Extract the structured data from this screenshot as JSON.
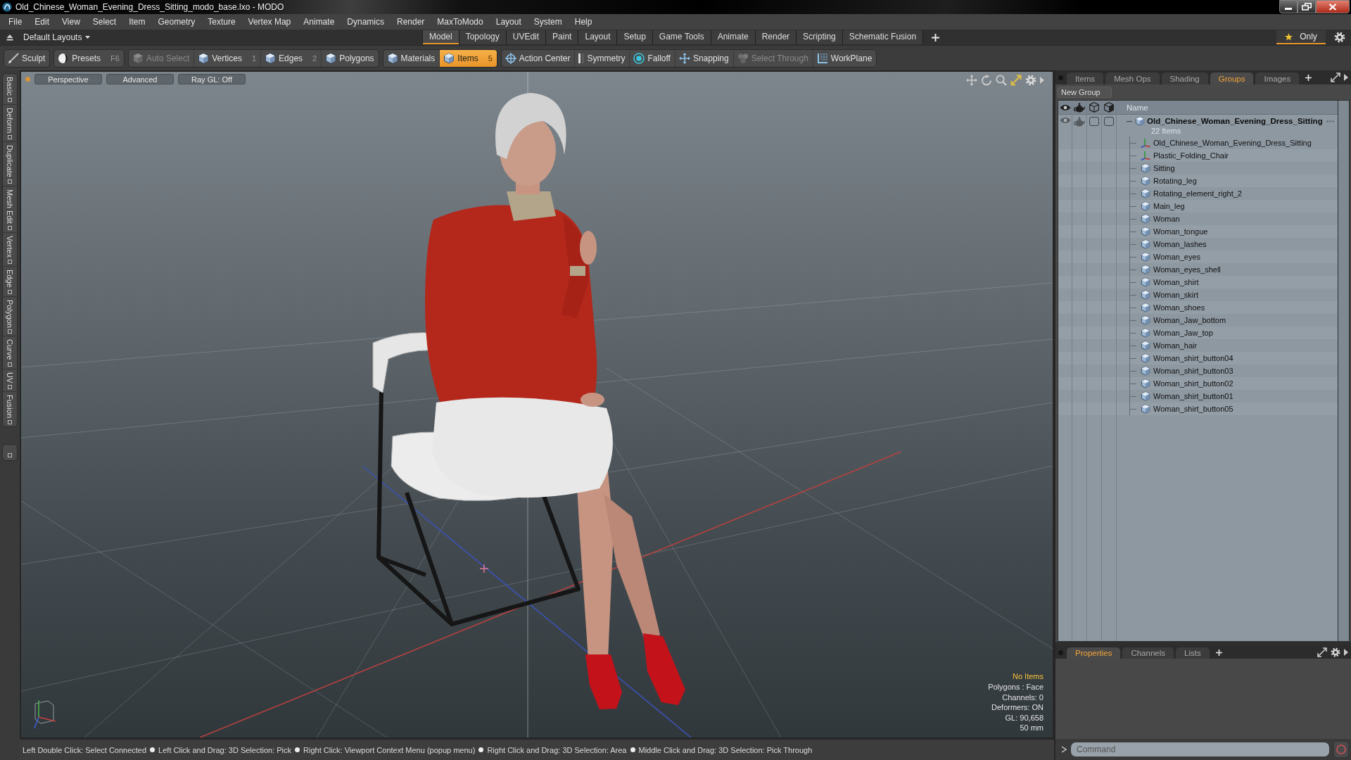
{
  "window": {
    "title": "Old_Chinese_Woman_Evening_Dress_Sitting_modo_base.lxo - MODO"
  },
  "menu": [
    "File",
    "Edit",
    "View",
    "Select",
    "Item",
    "Geometry",
    "Texture",
    "Vertex Map",
    "Animate",
    "Dynamics",
    "Render",
    "MaxToModo",
    "Layout",
    "System",
    "Help"
  ],
  "layout_bar": {
    "preset": "Default Layouts",
    "tabs": [
      {
        "label": "Model",
        "selected": true
      },
      {
        "label": "Topology",
        "selected": false
      },
      {
        "label": "UVEdit",
        "selected": false
      },
      {
        "label": "Paint",
        "selected": false
      },
      {
        "label": "Layout",
        "selected": false
      },
      {
        "label": "Setup",
        "selected": false
      },
      {
        "label": "Game Tools",
        "selected": false
      },
      {
        "label": "Animate",
        "selected": false
      },
      {
        "label": "Render",
        "selected": false
      },
      {
        "label": "Scripting",
        "selected": false
      },
      {
        "label": "Schematic Fusion",
        "selected": false
      }
    ],
    "only": "Only"
  },
  "toolbar": [
    {
      "items": [
        {
          "label": "Sculpt",
          "selected": false,
          "disabled": false
        }
      ]
    },
    {
      "items": [
        {
          "label": "Presets",
          "shortcut": "F6",
          "selected": false,
          "disabled": false
        }
      ]
    },
    {
      "items": [
        {
          "label": "Auto Select",
          "selected": false,
          "disabled": true
        },
        {
          "label": "Vertices",
          "shortcut": "1",
          "selected": false,
          "disabled": false
        },
        {
          "label": "Edges",
          "shortcut": "2",
          "selected": false,
          "disabled": false
        },
        {
          "label": "Polygons",
          "selected": false,
          "disabled": false
        }
      ]
    },
    {
      "items": [
        {
          "label": "Materials",
          "selected": false,
          "disabled": false
        },
        {
          "label": "Items",
          "shortcut": "5",
          "selected": true,
          "disabled": false
        }
      ]
    },
    {
      "items": [
        {
          "label": "Action Center",
          "selected": false,
          "disabled": false
        },
        {
          "label": "Symmetry",
          "selected": false,
          "disabled": false
        },
        {
          "label": "Falloff",
          "selected": false,
          "disabled": false
        },
        {
          "label": "Snapping",
          "selected": false,
          "disabled": false
        },
        {
          "label": "Select Through",
          "selected": false,
          "disabled": true
        },
        {
          "label": "WorkPlane",
          "selected": false,
          "disabled": false
        }
      ]
    }
  ],
  "side_tabs": [
    "Basic",
    "Deform",
    "Duplicate",
    "Mesh Edit",
    "Vertex",
    "Edge",
    "Polygon",
    "Curve",
    "UV",
    "Fusion"
  ],
  "viewport": {
    "buttons": [
      "Perspective",
      "Advanced",
      "Ray GL: Off"
    ],
    "info": [
      {
        "text": "No Items",
        "kind": "highlight"
      },
      {
        "text": "Polygons : Face",
        "kind": "plain"
      },
      {
        "text": "Channels: 0",
        "kind": "plain"
      },
      {
        "text": "Deformers: ON",
        "kind": "plain"
      },
      {
        "text": "GL: 90,658",
        "kind": "plain"
      },
      {
        "text": "50 mm",
        "kind": "plain"
      }
    ]
  },
  "status_bar": {
    "hints": [
      "Left Double Click: Select Connected",
      "Left Click and Drag: 3D Selection: Pick",
      "Right Click: Viewport Context Menu (popup menu)",
      "Right Click and Drag: 3D Selection: Area",
      "Middle Click and Drag: 3D Selection: Pick Through"
    ]
  },
  "panel_tabs": [
    {
      "label": "Items",
      "selected": false
    },
    {
      "label": "Mesh Ops",
      "selected": false
    },
    {
      "label": "Shading",
      "selected": false
    },
    {
      "label": "Groups",
      "selected": true
    },
    {
      "label": "Images",
      "selected": false
    }
  ],
  "groups": {
    "new_group": "New Group",
    "name_column": "Name",
    "root": {
      "name": "Old_Chinese_Woman_Evening_Dress_Sitting",
      "count": "22 Items",
      "expanded": true,
      "children": [
        {
          "name": "Old_Chinese_Woman_Evening_Dress_Sitting",
          "kind": "locator"
        },
        {
          "name": "Plastic_Folding_Chair",
          "kind": "locator"
        },
        {
          "name": "Sitting",
          "kind": "mesh"
        },
        {
          "name": "Rotating_leg",
          "kind": "mesh"
        },
        {
          "name": "Rotating_element_right_2",
          "kind": "mesh"
        },
        {
          "name": "Main_leg",
          "kind": "mesh"
        },
        {
          "name": "Woman",
          "kind": "mesh"
        },
        {
          "name": "Woman_tongue",
          "kind": "mesh"
        },
        {
          "name": "Woman_lashes",
          "kind": "mesh"
        },
        {
          "name": "Woman_eyes",
          "kind": "mesh"
        },
        {
          "name": "Woman_eyes_shell",
          "kind": "mesh"
        },
        {
          "name": "Woman_shirt",
          "kind": "mesh"
        },
        {
          "name": "Woman_skirt",
          "kind": "mesh"
        },
        {
          "name": "Woman_shoes",
          "kind": "mesh"
        },
        {
          "name": "Woman_Jaw_bottom",
          "kind": "mesh"
        },
        {
          "name": "Woman_Jaw_top",
          "kind": "mesh"
        },
        {
          "name": "Woman_hair",
          "kind": "mesh"
        },
        {
          "name": "Woman_shirt_button04",
          "kind": "mesh"
        },
        {
          "name": "Woman_shirt_button03",
          "kind": "mesh"
        },
        {
          "name": "Woman_shirt_button02",
          "kind": "mesh"
        },
        {
          "name": "Woman_shirt_button01",
          "kind": "mesh"
        },
        {
          "name": "Woman_shirt_button05",
          "kind": "mesh"
        }
      ]
    }
  },
  "properties_tabs": [
    {
      "label": "Properties",
      "selected": true
    },
    {
      "label": "Channels",
      "selected": false
    },
    {
      "label": "Lists",
      "selected": false
    }
  ],
  "command": {
    "placeholder": "Command"
  }
}
